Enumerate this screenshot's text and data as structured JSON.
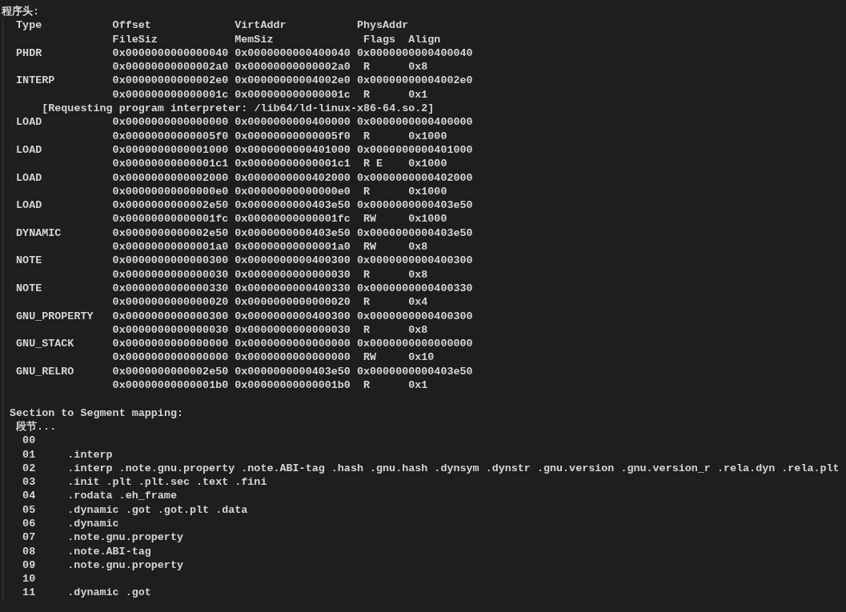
{
  "heading": "程序头:",
  "columns": {
    "type": "Type",
    "offset": "Offset",
    "virt_addr": "VirtAddr",
    "phys_addr": "PhysAddr",
    "file_siz": "FileSiz",
    "mem_siz": "MemSiz",
    "flags": "Flags",
    "align": "Align"
  },
  "segments": [
    {
      "type": "PHDR",
      "offset": "0x0000000000000040",
      "virt_addr": "0x0000000000400040",
      "phys_addr": "0x0000000000400040",
      "file_siz": "0x00000000000002a0",
      "mem_siz": "0x00000000000002a0",
      "flags": "R",
      "align": "0x8"
    },
    {
      "type": "INTERP",
      "offset": "0x00000000000002e0",
      "virt_addr": "0x00000000004002e0",
      "phys_addr": "0x00000000004002e0",
      "file_siz": "0x000000000000001c",
      "mem_siz": "0x000000000000001c",
      "flags": "R",
      "align": "0x1",
      "note": "[Requesting program interpreter: /lib64/ld-linux-x86-64.so.2]"
    },
    {
      "type": "LOAD",
      "offset": "0x0000000000000000",
      "virt_addr": "0x0000000000400000",
      "phys_addr": "0x0000000000400000",
      "file_siz": "0x00000000000005f0",
      "mem_siz": "0x00000000000005f0",
      "flags": "R",
      "align": "0x1000"
    },
    {
      "type": "LOAD",
      "offset": "0x0000000000001000",
      "virt_addr": "0x0000000000401000",
      "phys_addr": "0x0000000000401000",
      "file_siz": "0x00000000000001c1",
      "mem_siz": "0x00000000000001c1",
      "flags": "R E",
      "align": "0x1000"
    },
    {
      "type": "LOAD",
      "offset": "0x0000000000002000",
      "virt_addr": "0x0000000000402000",
      "phys_addr": "0x0000000000402000",
      "file_siz": "0x00000000000000e0",
      "mem_siz": "0x00000000000000e0",
      "flags": "R",
      "align": "0x1000"
    },
    {
      "type": "LOAD",
      "offset": "0x0000000000002e50",
      "virt_addr": "0x0000000000403e50",
      "phys_addr": "0x0000000000403e50",
      "file_siz": "0x00000000000001fc",
      "mem_siz": "0x00000000000001fc",
      "flags": "RW",
      "align": "0x1000"
    },
    {
      "type": "DYNAMIC",
      "offset": "0x0000000000002e50",
      "virt_addr": "0x0000000000403e50",
      "phys_addr": "0x0000000000403e50",
      "file_siz": "0x00000000000001a0",
      "mem_siz": "0x00000000000001a0",
      "flags": "RW",
      "align": "0x8"
    },
    {
      "type": "NOTE",
      "offset": "0x0000000000000300",
      "virt_addr": "0x0000000000400300",
      "phys_addr": "0x0000000000400300",
      "file_siz": "0x0000000000000030",
      "mem_siz": "0x0000000000000030",
      "flags": "R",
      "align": "0x8"
    },
    {
      "type": "NOTE",
      "offset": "0x0000000000000330",
      "virt_addr": "0x0000000000400330",
      "phys_addr": "0x0000000000400330",
      "file_siz": "0x0000000000000020",
      "mem_siz": "0x0000000000000020",
      "flags": "R",
      "align": "0x4"
    },
    {
      "type": "GNU_PROPERTY",
      "offset": "0x0000000000000300",
      "virt_addr": "0x0000000000400300",
      "phys_addr": "0x0000000000400300",
      "file_siz": "0x0000000000000030",
      "mem_siz": "0x0000000000000030",
      "flags": "R",
      "align": "0x8"
    },
    {
      "type": "GNU_STACK",
      "offset": "0x0000000000000000",
      "virt_addr": "0x0000000000000000",
      "phys_addr": "0x0000000000000000",
      "file_siz": "0x0000000000000000",
      "mem_siz": "0x0000000000000000",
      "flags": "RW",
      "align": "0x10"
    },
    {
      "type": "GNU_RELRO",
      "offset": "0x0000000000002e50",
      "virt_addr": "0x0000000000403e50",
      "phys_addr": "0x0000000000403e50",
      "file_siz": "0x00000000000001b0",
      "mem_siz": "0x00000000000001b0",
      "flags": "R",
      "align": "0x1"
    }
  ],
  "mapping": {
    "title": "Section to Segment mapping:",
    "header": "段节...",
    "rows": [
      {
        "segment": "00"
      },
      {
        "segment": "01",
        "sections": ".interp"
      },
      {
        "segment": "02",
        "sections": ".interp .note.gnu.property .note.ABI-tag .hash .gnu.hash .dynsym .dynstr .gnu.version .gnu.version_r .rela.dyn .rela.plt"
      },
      {
        "segment": "03",
        "sections": ".init .plt .plt.sec .text .fini"
      },
      {
        "segment": "04",
        "sections": ".rodata .eh_frame"
      },
      {
        "segment": "05",
        "sections": ".dynamic .got .got.plt .data"
      },
      {
        "segment": "06",
        "sections": ".dynamic"
      },
      {
        "segment": "07",
        "sections": ".note.gnu.property"
      },
      {
        "segment": "08",
        "sections": ".note.ABI-tag"
      },
      {
        "segment": "09",
        "sections": ".note.gnu.property"
      },
      {
        "segment": "10"
      },
      {
        "segment": "11",
        "sections": ".dynamic .got"
      }
    ]
  }
}
